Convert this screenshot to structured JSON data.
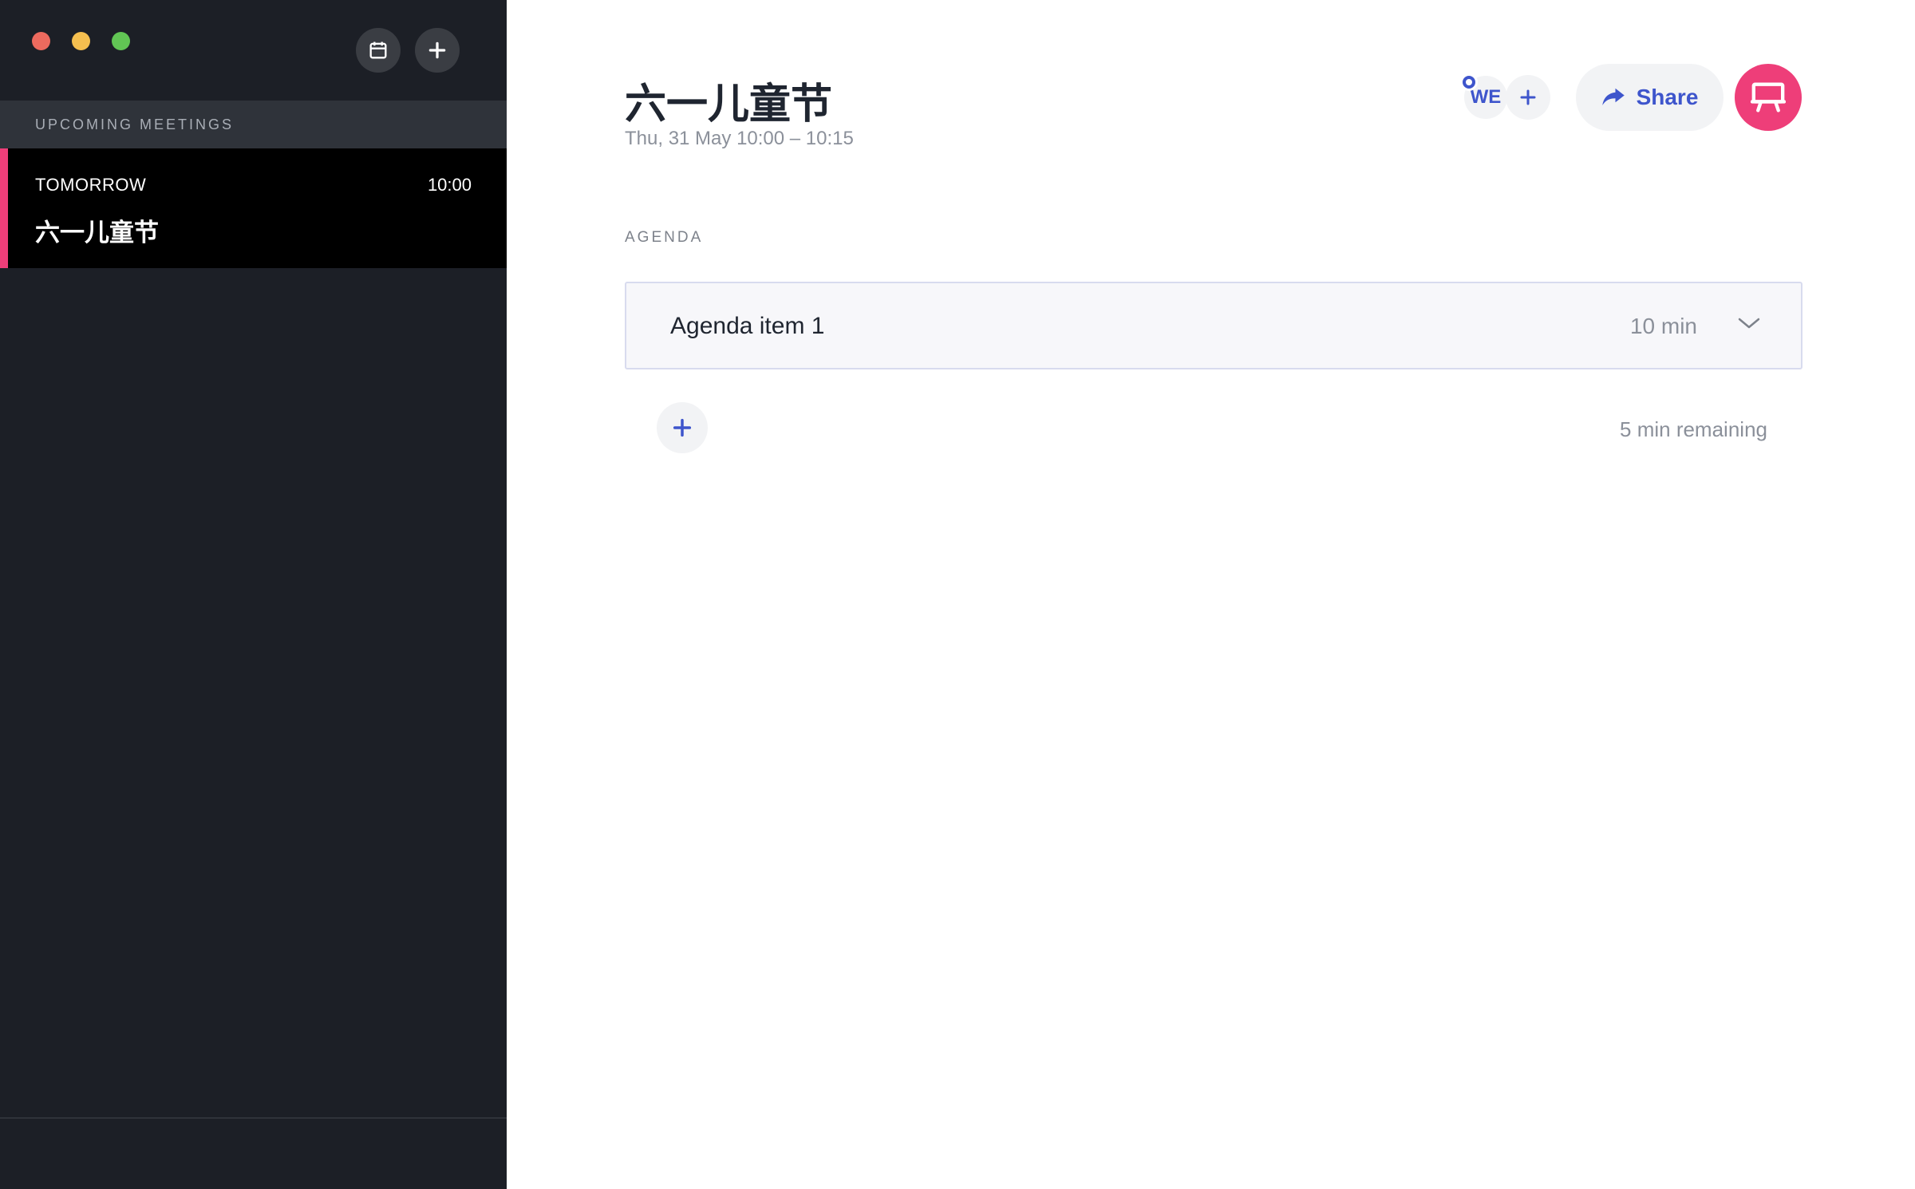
{
  "sidebar": {
    "section_header": "UPCOMING MEETINGS",
    "meetings": [
      {
        "when": "TOMORROW",
        "time": "10:00",
        "title": "六一儿童节"
      }
    ],
    "icons": {
      "calendar": "calendar-icon",
      "add": "plus-icon"
    }
  },
  "meeting": {
    "title": "六一儿童节",
    "date": "Thu, 31 May 10:00 – 10:15",
    "participant_initials": "WE",
    "share_label": "Share",
    "agenda_label": "AGENDA",
    "agenda_items": [
      {
        "name": "Agenda item 1",
        "duration": "10 min"
      }
    ],
    "remaining": "5 min remaining"
  },
  "colors": {
    "sidebar_bg": "#1c1f26",
    "accent_pink": "#ee3e79",
    "accent_blue": "#3e55cc"
  }
}
